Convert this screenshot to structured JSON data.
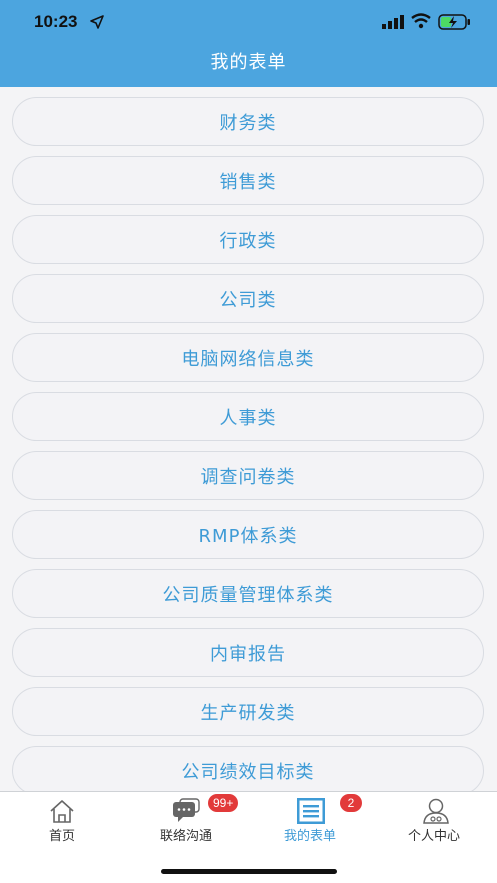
{
  "status_bar": {
    "time": "10:23"
  },
  "header": {
    "title": "我的表单"
  },
  "categories": [
    "财务类",
    "销售类",
    "行政类",
    "公司类",
    "电脑网络信息类",
    "人事类",
    "调查问卷类",
    "RMP体系类",
    "公司质量管理体系类",
    "内审报告",
    "生产研发类",
    "公司绩效目标类"
  ],
  "tabs": [
    {
      "label": "首页",
      "icon": "home-icon",
      "badge": ""
    },
    {
      "label": "联络沟通",
      "icon": "chat-icon",
      "badge": "99+"
    },
    {
      "label": "我的表单",
      "icon": "form-list-icon",
      "badge": "2",
      "active": true
    },
    {
      "label": "个人中心",
      "icon": "user-icon",
      "badge": ""
    }
  ],
  "colors": {
    "header_bg": "#4ca5df",
    "item_text": "#3e9bd6",
    "active_tab": "#3e9bd6",
    "badge": "#e23a3a"
  }
}
